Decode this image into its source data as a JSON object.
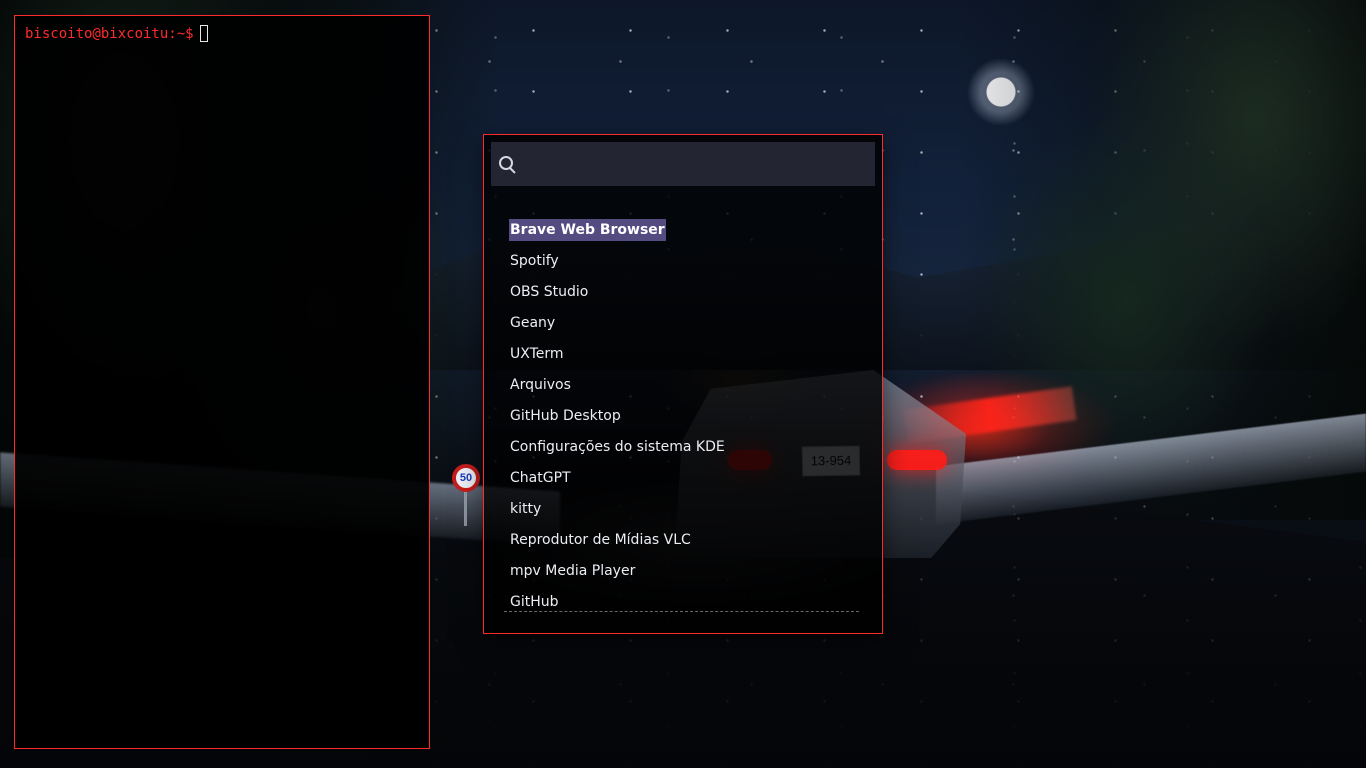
{
  "terminal": {
    "prompt": "biscoito@bixcoitu:~$"
  },
  "launcher": {
    "search": {
      "value": "",
      "placeholder": ""
    },
    "apps": [
      {
        "label": "Brave Web Browser",
        "selected": true
      },
      {
        "label": "Spotify"
      },
      {
        "label": "OBS Studio"
      },
      {
        "label": "Geany"
      },
      {
        "label": "UXTerm"
      },
      {
        "label": "Arquivos"
      },
      {
        "label": "GitHub Desktop"
      },
      {
        "label": "Configurações do sistema KDE"
      },
      {
        "label": "ChatGPT"
      },
      {
        "label": "kitty"
      },
      {
        "label": "Reprodutor de Mídias VLC"
      },
      {
        "label": "mpv Media Player"
      },
      {
        "label": "GitHub"
      }
    ]
  },
  "wallpaper": {
    "speed_sign": "50",
    "plate": "13-954"
  },
  "colors": {
    "accent_red": "#ff2b2b",
    "selection_purple": "#544b80",
    "search_background": "#282b38"
  }
}
